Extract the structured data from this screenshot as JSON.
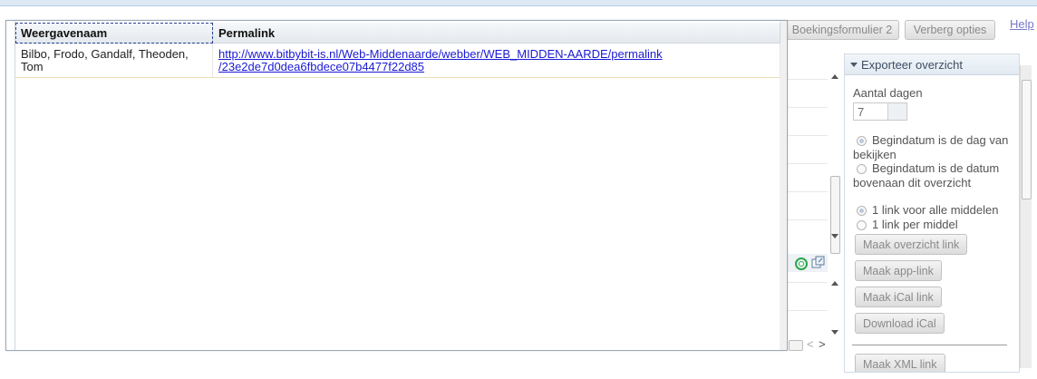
{
  "toolbar": {
    "boekingsformulier_label": "Boekingsformulier 2",
    "verberg_opties_label": "Verberg opties",
    "help_label": "Help"
  },
  "options_panel": {
    "header": "Exporteer overzicht",
    "aantal_dagen_label": "Aantal dagen",
    "aantal_dagen_value": "7",
    "begindatum_dag_label_1": "Begindatum is de dag van",
    "begindatum_dag_label_2": "bekijken",
    "begindatum_datum_label_1": "Begindatum is de datum",
    "begindatum_datum_label_2": "bovenaan dit overzicht",
    "link_alle_label": "1 link voor alle middelen",
    "link_per_label": "1 link per middel",
    "buttons": {
      "overzicht": "Maak overzicht link",
      "app": "Maak app-link",
      "ical": "Maak iCal link",
      "download": "Download iCal",
      "xml": "Maak XML link"
    }
  },
  "dialog": {
    "columns": [
      "Weergavenaam",
      "Permalink"
    ],
    "rows": [
      {
        "name_line1": "Bilbo, Frodo, Gandalf, Theoden,",
        "name_line2": "Tom",
        "link_line1": "http://www.bitbybit-is.nl/Web-Middenaarde/webber/WEB_MIDDEN-AARDE/permalink",
        "link_line2": "/23e2de7d0dea6fbdece07b4477f22d85"
      }
    ]
  },
  "icons": {
    "refresh": "refresh-icon",
    "popout": "popout-icon"
  },
  "colors": {
    "link": "#1a1ad6",
    "panel_header": "#3d4f63",
    "refresh_green": "#2aa84a"
  }
}
